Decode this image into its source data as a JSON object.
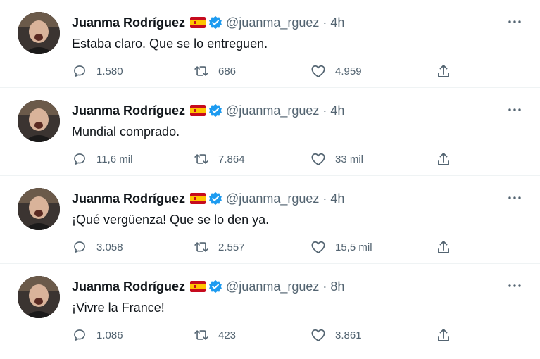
{
  "tweets": [
    {
      "author_name": "Juanma Rodríguez",
      "handle": "@juanma_rguez",
      "separator": "·",
      "time": "4h",
      "text": "Estaba claro. Que se lo entreguen.",
      "replies": "1.580",
      "retweets": "686",
      "likes": "4.959"
    },
    {
      "author_name": "Juanma Rodríguez",
      "handle": "@juanma_rguez",
      "separator": "·",
      "time": "4h",
      "text": "Mundial comprado.",
      "replies": "11,6 mil",
      "retweets": "7.864",
      "likes": "33 mil"
    },
    {
      "author_name": "Juanma Rodríguez",
      "handle": "@juanma_rguez",
      "separator": "·",
      "time": "4h",
      "text": "¡Qué vergüenza! Que se lo den ya.",
      "replies": "3.058",
      "retweets": "2.557",
      "likes": "15,5 mil"
    },
    {
      "author_name": "Juanma Rodríguez",
      "handle": "@juanma_rguez",
      "separator": "·",
      "time": "8h",
      "text": "¡Vivre la France!",
      "replies": "1.086",
      "retweets": "423",
      "likes": "3.861"
    }
  ],
  "icons": {
    "reply": "reply-icon",
    "retweet": "retweet-icon",
    "like": "heart-icon",
    "share": "share-icon",
    "more": "more-options-icon",
    "verified": "verified-badge-icon",
    "flag": "spain-flag-icon"
  },
  "colors": {
    "verified": "#1d9bf0",
    "secondary_text": "#536471",
    "primary_text": "#0f1419",
    "flag_red": "#c60b1e",
    "flag_yellow": "#ffc400"
  }
}
